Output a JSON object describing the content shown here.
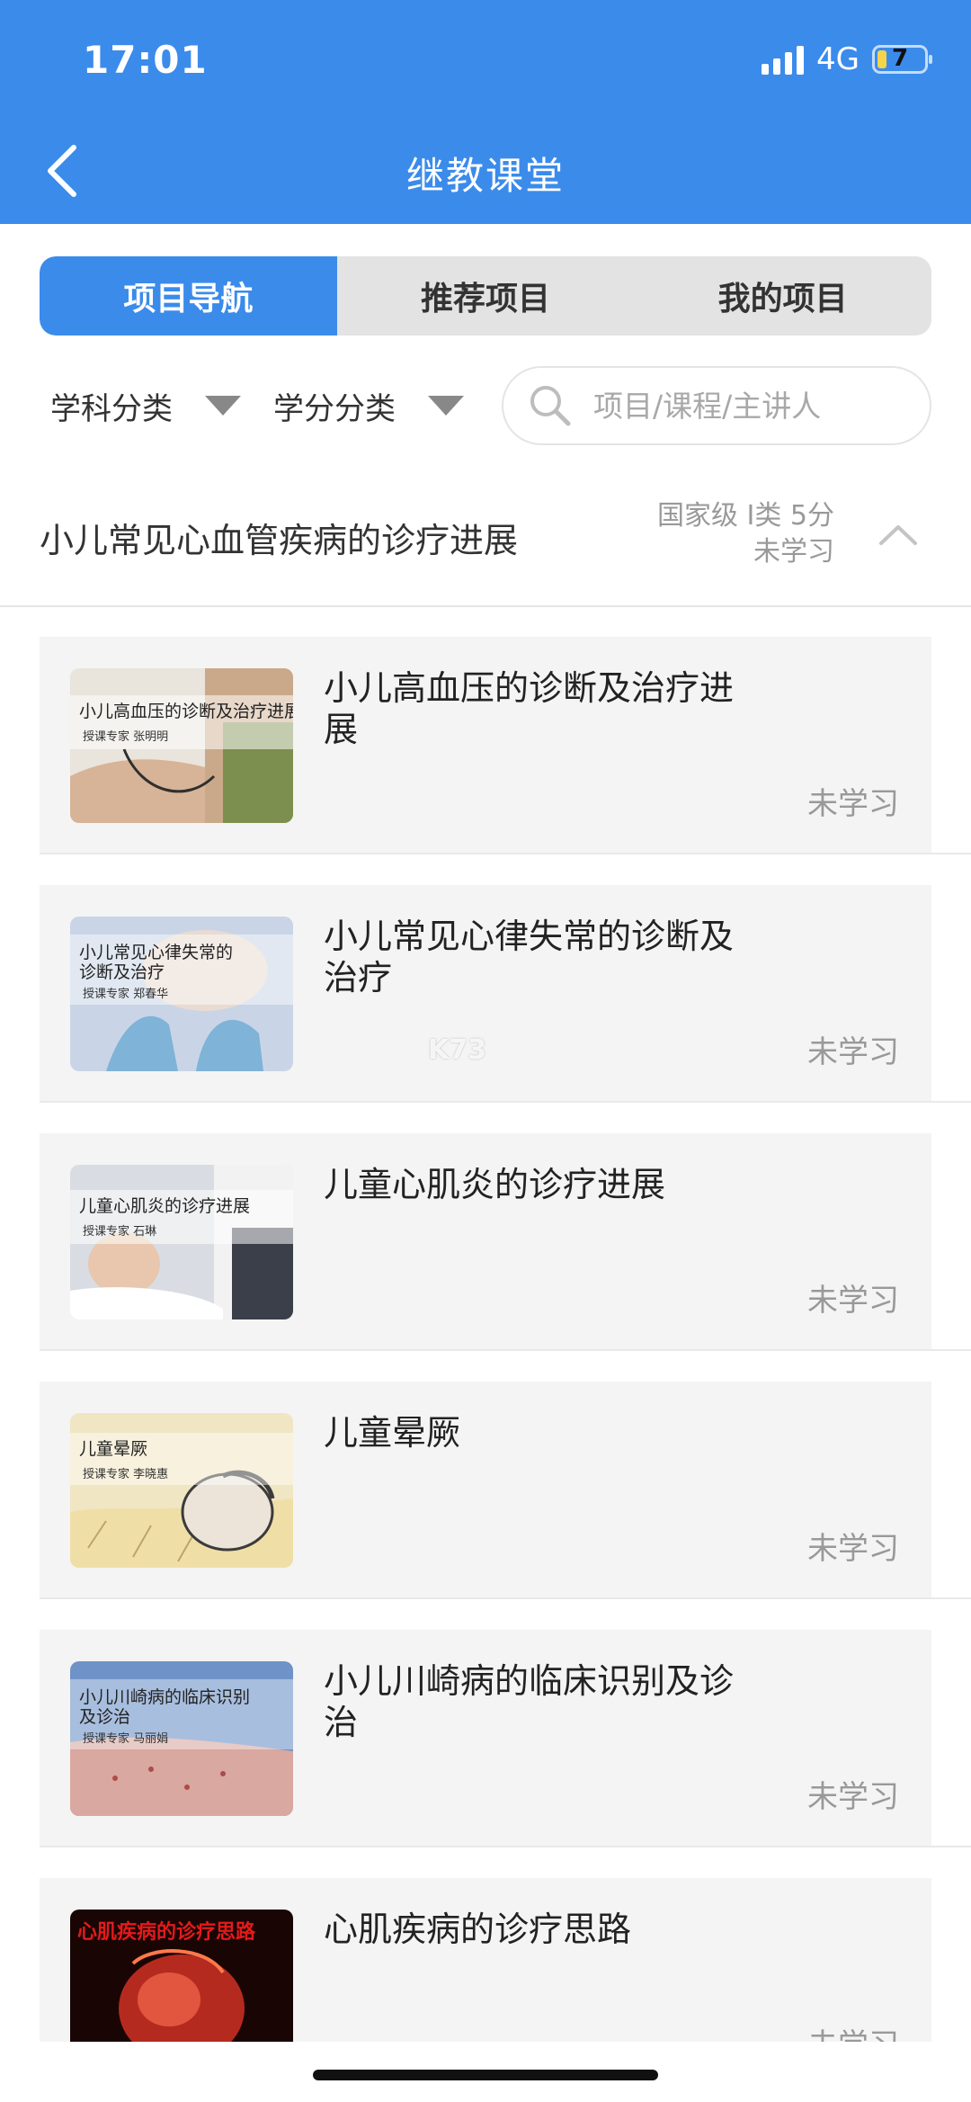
{
  "status_bar": {
    "time": "17:01",
    "network": "4G",
    "battery": "7"
  },
  "header": {
    "title": "继教课堂"
  },
  "tabs": [
    {
      "label": "项目导航",
      "active": true
    },
    {
      "label": "推荐项目",
      "active": false
    },
    {
      "label": "我的项目",
      "active": false
    }
  ],
  "filters": {
    "subject": "学科分类",
    "credit": "学分分类",
    "search_placeholder": "项目/课程/主讲人"
  },
  "section": {
    "title": "小儿常见心血管疾病的诊疗进展",
    "meta_line1": "国家级 I类 5分",
    "meta_line2": "未学习"
  },
  "courses": [
    {
      "title": "小儿高血压的诊断及治疗进展",
      "status": "未学习",
      "thumb_title": "小儿高血压的诊断及治疗进展",
      "thumb_sub": "授课专家 张明明"
    },
    {
      "title": "小儿常见心律失常的诊断及治疗",
      "status": "未学习",
      "thumb_title": "小儿常见心律失常的诊断及治疗",
      "thumb_sub": "授课专家 郑春华"
    },
    {
      "title": "儿童心肌炎的诊疗进展",
      "status": "未学习",
      "thumb_title": "儿童心肌炎的诊疗进展",
      "thumb_sub": "授课专家 石琳"
    },
    {
      "title": "儿童晕厥",
      "status": "未学习",
      "thumb_title": "儿童晕厥",
      "thumb_sub": "授课专家 李晓惠"
    },
    {
      "title": "小儿川崎病的临床识别及诊治",
      "status": "未学习",
      "thumb_title": "小儿川崎病的临床识别及诊治",
      "thumb_sub": "授课专家 马丽娟"
    },
    {
      "title": "心肌疾病的诊疗思路",
      "status": "未学习",
      "thumb_title": "心肌疾病的诊疗思路",
      "thumb_sub": ""
    }
  ],
  "watermark": "K73"
}
